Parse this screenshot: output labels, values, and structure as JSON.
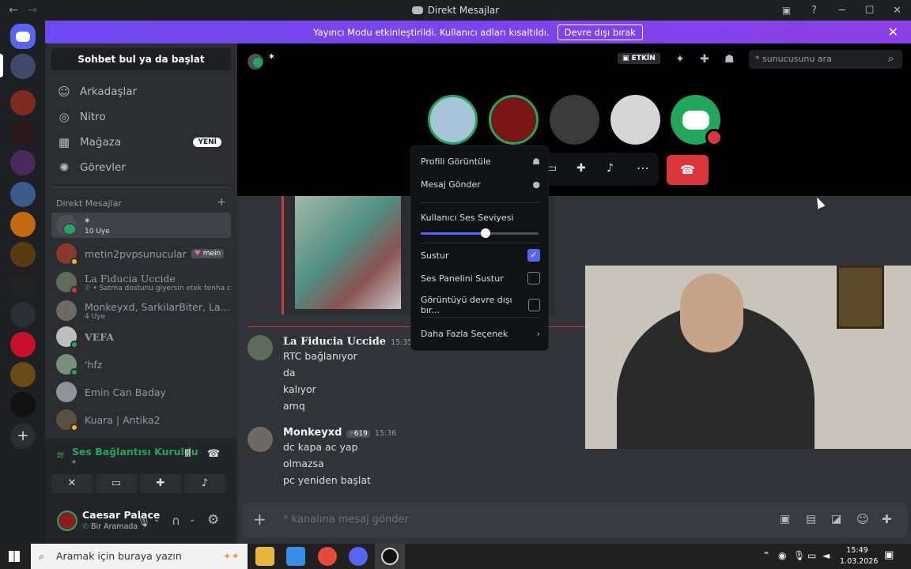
{
  "window": {
    "title": "Direkt Mesajlar",
    "back_glyph": "←",
    "forward_glyph": "→",
    "controls": {
      "minimize": "─",
      "maximize": "☐",
      "close": "✕"
    }
  },
  "banner": {
    "text": "Yayıncı Modu etkinleştirildi. Kullanıcı adları kısaltıldı.",
    "button": "Devre dışı bırak",
    "close": "✕"
  },
  "sidebar": {
    "search_button": "Sohbet bul ya da başlat",
    "nav": [
      {
        "label": "Arkadaşlar",
        "icon": "friends-icon",
        "glyph": "☺"
      },
      {
        "label": "Nitro",
        "icon": "nitro-icon",
        "glyph": "◎"
      },
      {
        "label": "Mağaza",
        "icon": "shop-icon",
        "glyph": "▦",
        "badge": "YENİ"
      },
      {
        "label": "Görevler",
        "icon": "quests-icon",
        "glyph": "✺"
      }
    ],
    "dm_header": "Direkt Mesajlar",
    "dm_add": "+",
    "dms": [
      {
        "name": "*",
        "sub": "10 Üye",
        "color": "#4e5058"
      },
      {
        "name": "metin2pvpsunucular",
        "tag": "mein",
        "color": "#8a3a2a"
      },
      {
        "name": "La Fiducia Uccide",
        "sub": "Satma dostunu giyersin etek tenha c",
        "color": "#5c6b5a"
      },
      {
        "name": "Monkeyxd, SarkilarBiter, La ...",
        "sub": "4 Üye",
        "color": "#6d6a63"
      },
      {
        "name": "VEFA",
        "color": "#bdbdbd"
      },
      {
        "name": "'hfz",
        "color": "#7a8d7a"
      },
      {
        "name": "Emin Can Baday",
        "color": "#8f9397"
      },
      {
        "name": "Kuara | Antika2",
        "color": "#5a5040"
      }
    ],
    "voice": {
      "status": "Ses Bağlantısı Kuruldu",
      "channel": "*"
    },
    "user": {
      "name": "Caesar Palace",
      "status": "Bir Aramada"
    }
  },
  "main": {
    "header_title": "*",
    "live_badge": "ETKİN",
    "search_placeholder": "* sunucusunu ara",
    "messages": [
      {
        "author": "La Fiducia Uccide",
        "time": "15:35",
        "lines": [
          "RTC bağlanıyor",
          "da",
          "kalıyor",
          "amq"
        ]
      },
      {
        "author": "Monkeyxd",
        "badge": "619",
        "time": "15:36",
        "lines": [
          "dc kapa ac yap",
          "olmazsa",
          "pc yeniden başlat"
        ]
      }
    ],
    "input_placeholder": "* kanalına mesaj gönder",
    "input_plus": "+"
  },
  "context_menu": {
    "view_profile": "Profili Görüntüle",
    "send_message": "Mesaj Gönder",
    "volume_label": "Kullanıcı Ses Seviyesi",
    "volume_fraction": 0.55,
    "mute": "Sustur",
    "mute_soundboard": "Ses Panelini Sustur",
    "disable_video": "Görüntüyü devre dışı bır...",
    "more": "Daha Fazla Seçenek",
    "mute_checked": true,
    "mute_soundboard_checked": false,
    "disable_video_checked": false
  },
  "taskbar": {
    "search_placeholder": "Aramak için buraya yazın",
    "time": "15:49",
    "date": "1.03.2026"
  },
  "colors": {
    "accent": "#5865f2",
    "danger": "#da373c",
    "online": "#23a55a",
    "idle": "#f0b232"
  }
}
